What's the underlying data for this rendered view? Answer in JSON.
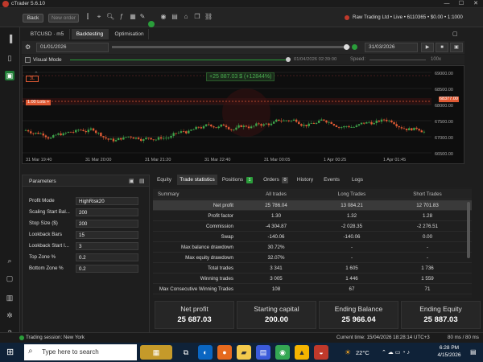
{
  "window": {
    "title": "cTrader 5.6.10",
    "min": "—",
    "max": "☐",
    "close": "✕"
  },
  "toolbar": {
    "back": "Back",
    "new_order": "New order",
    "account": "Raw Trading Ltd • Live • 6110365 • $0.00 • 1:1000"
  },
  "tabs": [
    {
      "label": "BTCUSD · m5"
    },
    {
      "label": "Backtesting"
    },
    {
      "label": "Optimisation"
    }
  ],
  "controls": {
    "start_date": "01/01/2026",
    "end_date": "31/03/2026"
  },
  "visual": {
    "label": "Visual Mode",
    "time": "01/04/2026 02:39:00",
    "speed_label": "Speed:",
    "speed_value": "100x"
  },
  "chart": {
    "symbol": "3L",
    "pnl": "+25 887.03 $ (+12844%)",
    "trade_label": "1.00 Lots +",
    "price_badge": "68377.00",
    "y_ticks": [
      "69000.00",
      "68500.00",
      "68000.00",
      "67500.00",
      "67000.00",
      "66500.00"
    ],
    "x_ticks": [
      "31 Mar 19:40",
      "31 Mar 20:00",
      "31 Mar 21:20",
      "31 Mar 22:40",
      "31 Mar 00:05",
      "1 Apr 00:25",
      "1 Apr 01:45"
    ]
  },
  "params": {
    "title": "Parameters",
    "rows": [
      {
        "label": "Profit Mode",
        "value": "HighRisk20"
      },
      {
        "label": "Scaling Start Bal...",
        "value": "200"
      },
      {
        "label": "Stop Size ($)",
        "value": "200"
      },
      {
        "label": "Lookback Bars",
        "value": "15"
      },
      {
        "label": "Lookback Start I...",
        "value": "3"
      },
      {
        "label": "Top Zone %",
        "value": "0.2"
      },
      {
        "label": "Bottom Zone %",
        "value": "0.2"
      }
    ]
  },
  "bottom_tabs": [
    {
      "label": "Equity"
    },
    {
      "label": "Trade statistics"
    },
    {
      "label": "Positions"
    },
    {
      "label": "Orders"
    },
    {
      "label": "History"
    },
    {
      "label": "Events"
    },
    {
      "label": "Logs"
    }
  ],
  "badges": {
    "positions": "1",
    "orders": "0"
  },
  "stats": {
    "headers": [
      "Summary",
      "All trades",
      "Long Trades",
      "Short Trades"
    ],
    "rows": [
      {
        "label": "Net profit",
        "all": "25 786.04",
        "long": "13 084.21",
        "short": "12 701.83"
      },
      {
        "label": "Profit factor",
        "all": "1.30",
        "long": "1.32",
        "short": "1.28"
      },
      {
        "label": "Commission",
        "all": "-4 304.87",
        "long": "-2 028.35",
        "short": "-2 276.51"
      },
      {
        "label": "Swap",
        "all": "-140.06",
        "long": "-140.06",
        "short": "0.00"
      },
      {
        "label": "Max balance drawdown",
        "all": "30.72%",
        "long": "-",
        "short": "-"
      },
      {
        "label": "Max equity drawdown",
        "all": "32.07%",
        "long": "-",
        "short": "-"
      },
      {
        "label": "Total trades",
        "all": "3 341",
        "long": "1 605",
        "short": "1 736"
      },
      {
        "label": "Winning trades",
        "all": "3 005",
        "long": "1 446",
        "short": "1 559"
      },
      {
        "label": "Max Consecutive Winning Trades",
        "all": "108",
        "long": "67",
        "short": "71"
      }
    ]
  },
  "cards": [
    {
      "label": "Net profit",
      "value": "25 687.03"
    },
    {
      "label": "Starting capital",
      "value": "200.00"
    },
    {
      "label": "Ending Balance",
      "value": "25 966.04"
    },
    {
      "label": "Ending Equity",
      "value": "25 887.03"
    }
  ],
  "status": {
    "session": "Trading session: New York",
    "time": "Current time: 15/04/2026 18:28:14  UTC+3",
    "latency": "80 ms / 80 ms"
  },
  "taskbar": {
    "search": "Type here to search",
    "temp": "22°C",
    "clock_time": "6:28 PM",
    "clock_date": "4/15/2026"
  },
  "colors": {
    "accent": "#2a9d3a",
    "bull": "#3ea34a",
    "bear": "#e05a34",
    "positive": "#4caf50"
  }
}
